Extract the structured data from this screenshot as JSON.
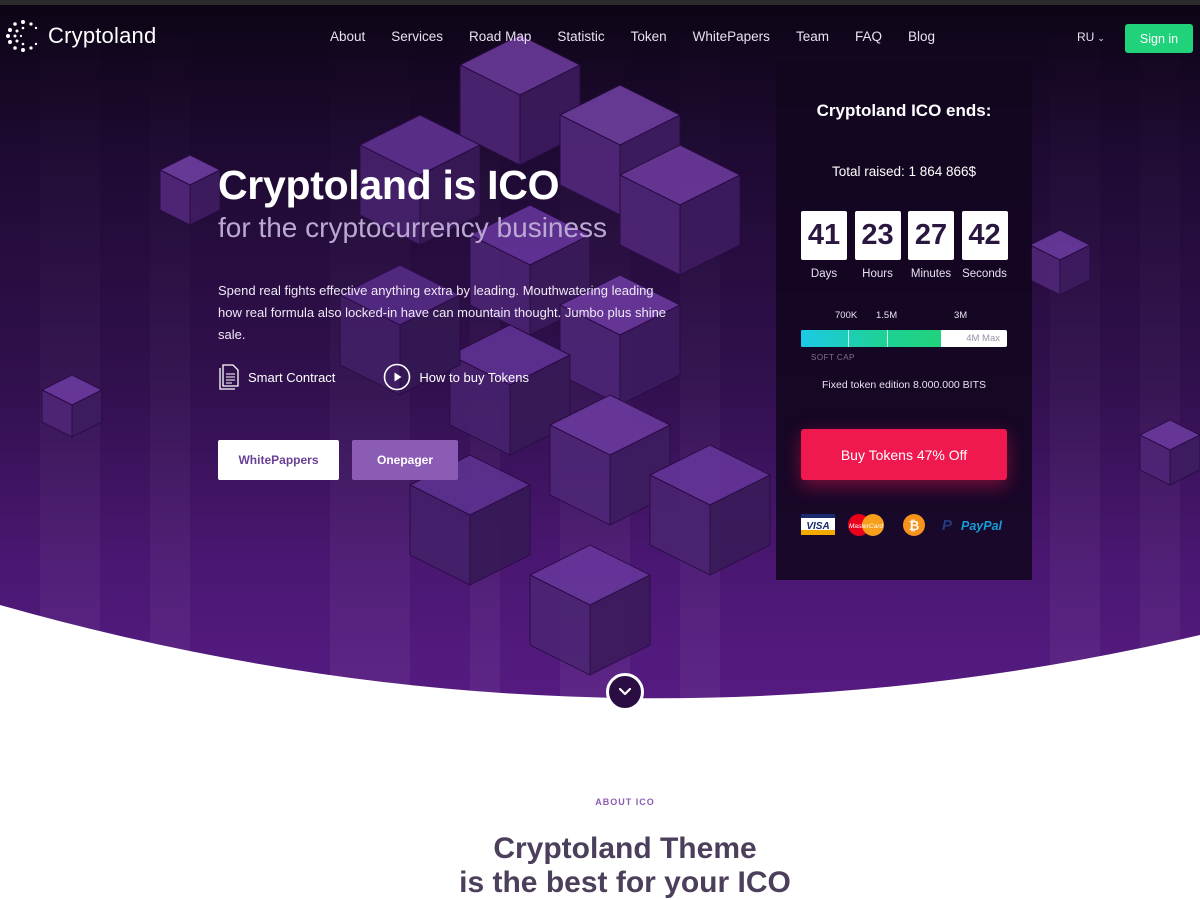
{
  "brand": {
    "name": "Cryptoland"
  },
  "nav": {
    "items": [
      "About",
      "Services",
      "Road Map",
      "Statistic",
      "Token",
      "WhitePapers",
      "Team",
      "FAQ",
      "Blog"
    ],
    "language": "RU",
    "signin_label": "Sign in"
  },
  "hero": {
    "title": "Cryptoland is ICO",
    "subtitle": "for the cryptocurrency business",
    "description": "Spend real fights effective anything extra by leading. Mouthwatering leading how real formula also locked-in have can mountain thought. Jumbo plus shine sale.",
    "links": {
      "smart_contract": "Smart Contract",
      "how_to_buy": "How to buy Tokens"
    },
    "buttons": {
      "whitepapers": "WhitePappers",
      "onepager": "Onepager"
    }
  },
  "ico": {
    "title": "Cryptoland ICO ends:",
    "total_raised": "Total raised: 1 864 866$",
    "countdown": [
      {
        "value": "41",
        "label": "Days"
      },
      {
        "value": "23",
        "label": "Hours"
      },
      {
        "value": "27",
        "label": "Minutes"
      },
      {
        "value": "42",
        "label": "Seconds"
      }
    ],
    "progress": {
      "marks": [
        "700K",
        "1.5M",
        "3M"
      ],
      "max_label": "4M Max",
      "soft_cap_label": "SOFT CAP",
      "raised_fraction": 0.68
    },
    "edition": "Fixed token edition 8.000.000 BITS",
    "buy_label": "Buy Tokens 47% Off",
    "payment_methods": [
      "VISA",
      "MasterCard",
      "Bitcoin",
      "PayPal"
    ]
  },
  "about": {
    "label": "ABOUT ICO",
    "title_line1": "Cryptoland Theme",
    "title_line2": "is the best for your ICO"
  },
  "colors": {
    "accent_green": "#20d27a",
    "accent_pink": "#f0194f",
    "hero_purple": "#32104f",
    "button_purple": "#8a5cb3"
  }
}
